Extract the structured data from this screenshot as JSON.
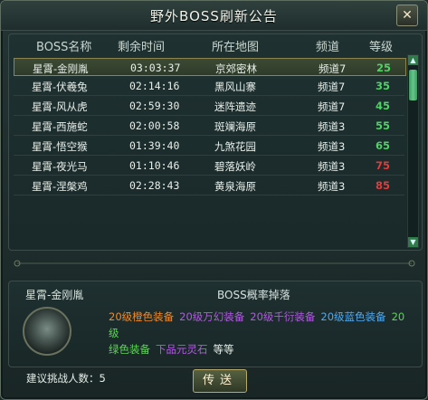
{
  "window": {
    "title": "野外BOSS刷新公告",
    "close_glyph": "✕"
  },
  "table": {
    "headers": [
      "BOSS名称",
      "剩余时间",
      "所在地图",
      "频道",
      "等级"
    ],
    "rows": [
      {
        "name": "星霄-金刚胤",
        "time": "03:03:37",
        "map": "京郊密林",
        "channel": "频道7",
        "level": "25",
        "level_color": "#4fd266",
        "selected": true
      },
      {
        "name": "星霄-伏羲兔",
        "time": "02:14:16",
        "map": "黑风山寨",
        "channel": "频道7",
        "level": "35",
        "level_color": "#4fd266"
      },
      {
        "name": "星霄-风从虎",
        "time": "02:59:30",
        "map": "迷阵遗迹",
        "channel": "频道7",
        "level": "45",
        "level_color": "#4fd266"
      },
      {
        "name": "星霄-西施蛇",
        "time": "02:00:58",
        "map": "斑斓海原",
        "channel": "频道3",
        "level": "55",
        "level_color": "#4fd266"
      },
      {
        "name": "星霄-悟空猴",
        "time": "01:39:40",
        "map": "九煞花园",
        "channel": "频道3",
        "level": "65",
        "level_color": "#4fd266"
      },
      {
        "name": "星霄-夜光马",
        "time": "01:10:46",
        "map": "碧落妖岭",
        "channel": "频道3",
        "level": "75",
        "level_color": "#e23b3b"
      },
      {
        "name": "星霄-涅槃鸡",
        "time": "02:28:43",
        "map": "黄泉海原",
        "channel": "频道3",
        "level": "85",
        "level_color": "#e23b3b"
      }
    ]
  },
  "detail": {
    "boss_name": "星霄-金刚胤",
    "drop_title": "BOSS概率掉落",
    "drops": [
      {
        "text": "20级橙色装备",
        "color": "#f08a2a"
      },
      {
        "text": "20级万幻装备",
        "color": "#b05be0"
      },
      {
        "text": "20级千衍装备",
        "color": "#b05be0"
      },
      {
        "text": "20级蓝色装备",
        "color": "#4ea9f2"
      },
      {
        "text": "20级",
        "color": "#5fd35a"
      },
      {
        "text": "绿色装备",
        "color": "#5fd35a"
      },
      {
        "text": "下品元灵石",
        "color": "#b05be0"
      },
      {
        "text": "等等",
        "color": "#e6efe8"
      }
    ]
  },
  "footer": {
    "suggest_label": "建议挑战人数：5",
    "send_label": "传送"
  }
}
